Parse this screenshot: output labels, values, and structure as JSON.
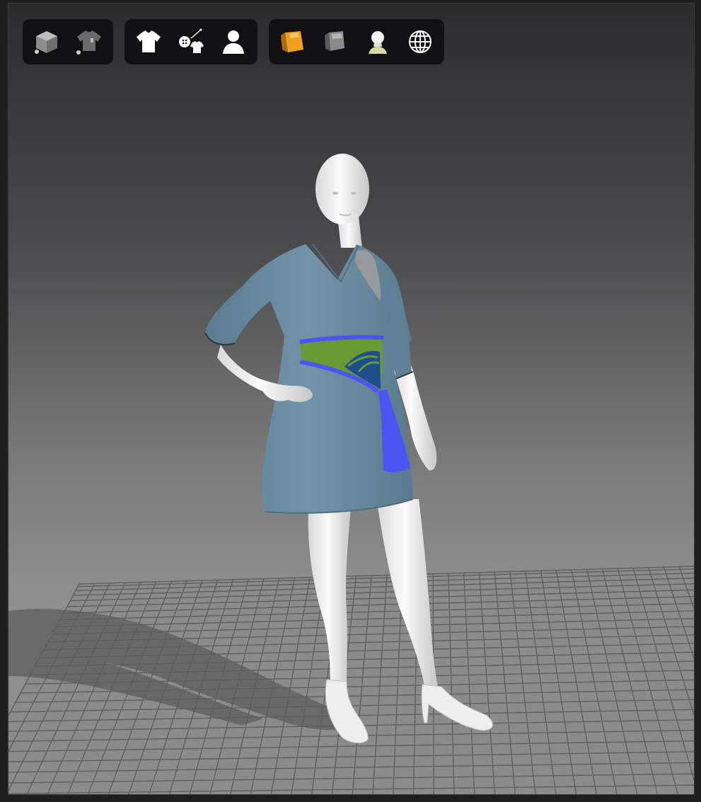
{
  "viewer": {
    "background_top": "#2c2c2e",
    "background_bottom": "#8c8c8d",
    "grid_color": "#5f5f61",
    "floor_color": "#8b8b8c"
  },
  "toolbar": {
    "groups": [
      {
        "name": "display-group",
        "buttons": [
          {
            "icon": "cube-display-icon"
          },
          {
            "icon": "garment-display-icon"
          }
        ]
      },
      {
        "name": "visibility-group",
        "buttons": [
          {
            "icon": "shirt-icon"
          },
          {
            "icon": "buttons-trims-icon"
          },
          {
            "icon": "avatar-icon"
          }
        ]
      },
      {
        "name": "render-group",
        "buttons": [
          {
            "icon": "fabric-texture-icon"
          },
          {
            "icon": "surface-icon"
          },
          {
            "icon": "avatar-skin-icon"
          },
          {
            "icon": "globe-icon"
          }
        ]
      }
    ]
  },
  "colors": {
    "dress": "#6a8aa0",
    "dress_shade": "#56768c",
    "belt_green": "#6a9a35",
    "belt_blue": "#4b55f2",
    "belt_dark": "#1f4f8a",
    "avatar": "#ececec",
    "avatar_shade": "#c9c9c9",
    "icon_orange": "#f0a020"
  }
}
